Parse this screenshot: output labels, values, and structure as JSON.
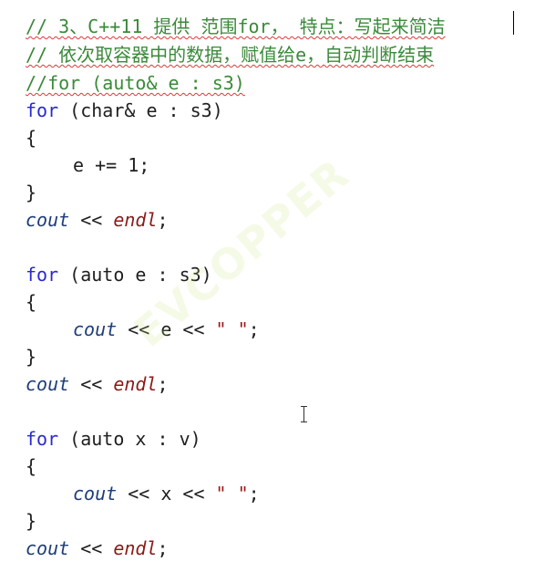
{
  "code_lines": {
    "l1": "// 3、C++11 提供 范围for， 特点：写起来简洁",
    "l2": "// 依次取容器中的数据，赋值给e，自动判断结束",
    "l3": "//for (auto& e : s3)",
    "l4_kw": "for",
    "l4_rest": " (char& e : s3)",
    "l5": "{",
    "l6": "e += 1;",
    "l7": "}",
    "l8_obj": "cout",
    "l8_op": " << ",
    "l8_manip": "endl",
    "l8_end": ";",
    "l10_kw": "for",
    "l10_rest": " (auto e : s3)",
    "l11": "{",
    "l12_obj": "cout",
    "l12_a": " << e << ",
    "l12_str": "\" \"",
    "l12_end": ";",
    "l13": "}",
    "l14_obj": "cout",
    "l14_op": " << ",
    "l14_manip": "endl",
    "l14_end": ";",
    "l16_kw": "for",
    "l16_rest": " (auto x : v)",
    "l17": "{",
    "l18_obj": "cout",
    "l18_a": " << x << ",
    "l18_str": "\" \"",
    "l18_end": ";",
    "l19": "}",
    "l20_obj": "cout",
    "l20_op": " << ",
    "l20_manip": "endl",
    "l20_end": ";"
  },
  "watermark_text": "EVCOPPER",
  "colors": {
    "comment": "#3a8a3a",
    "keyword": "#2a2ad0",
    "object": "#1e3d7a",
    "manipulator": "#8b1a1a",
    "string": "#a31515",
    "squiggle": "#d93a3a"
  }
}
